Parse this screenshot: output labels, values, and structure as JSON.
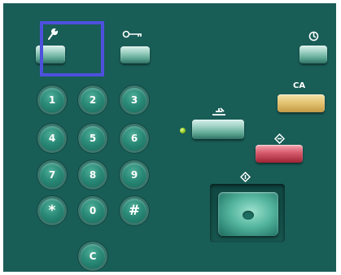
{
  "panel": {
    "background": "#195d57",
    "highlight_color": "#4d50dc"
  },
  "top_buttons": {
    "tools_icon": "wrench-icon",
    "access_icon": "key-icon",
    "energy_saver_icon": "energy-saver-icon"
  },
  "keypad": {
    "keys": [
      "1",
      "2",
      "3",
      "4",
      "5",
      "6",
      "7",
      "8",
      "9",
      "*",
      "0",
      "#"
    ],
    "clear_label": "C"
  },
  "right_buttons": {
    "ca_label": "CA",
    "ca_color": "#e3c16f",
    "interrupt_icon": "interrupt-icon",
    "stop_icon": "stop-icon",
    "stop_color": "#d65a6c",
    "start_icon": "start-icon"
  },
  "indicator": {
    "color": "#8cc21d"
  }
}
